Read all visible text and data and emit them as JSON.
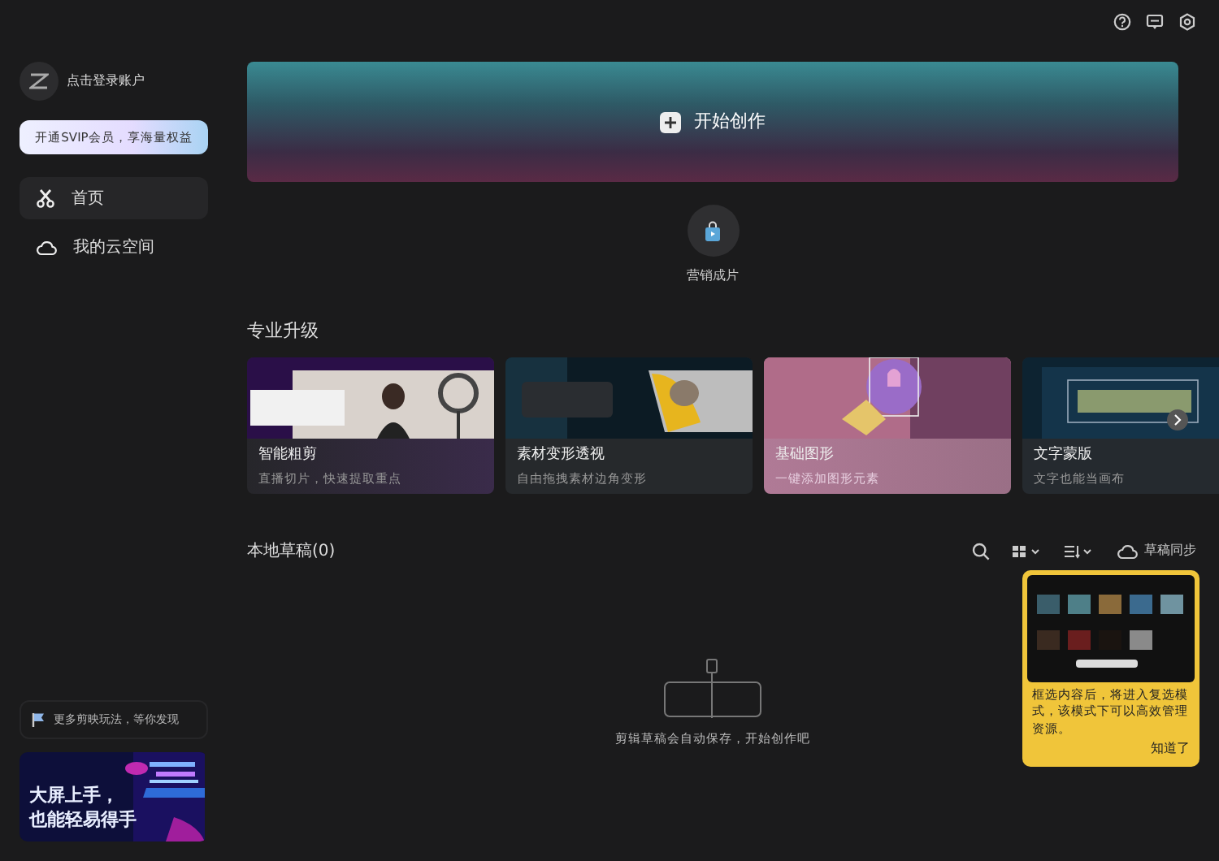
{
  "account": {
    "login": "点击登录账户",
    "vip_button": "开通SVIP会员，享海量权益"
  },
  "nav": [
    {
      "label": "首页",
      "selected": true
    },
    {
      "label": "我的云空间",
      "selected": false
    }
  ],
  "promo": {
    "label": "更多剪映玩法，等你发现",
    "banner_lines": [
      "大屏上手，",
      "也能轻易得手"
    ]
  },
  "hero": {
    "label": "开始创作"
  },
  "quick": [
    {
      "label": "营销成片"
    }
  ],
  "section": {
    "title": "专业升级",
    "cards": [
      {
        "title": "智能粗剪",
        "subtitle": "直播切片，快速提取重点"
      },
      {
        "title": "素材变形透视",
        "subtitle": "自由拖拽素材边角变形"
      },
      {
        "title": "基础图形",
        "subtitle": "一键添加图形元素"
      },
      {
        "title": "文字蒙版",
        "subtitle": "文字也能当画布"
      }
    ]
  },
  "drafts": {
    "title": "本地草稿(0)",
    "sync": "草稿同步",
    "empty": "剪辑草稿会自动保存，开始创作吧"
  },
  "tooltip": {
    "text": "框选内容后，将进入复选模式，该模式下可以高效管理资源。",
    "action": "知道了"
  }
}
